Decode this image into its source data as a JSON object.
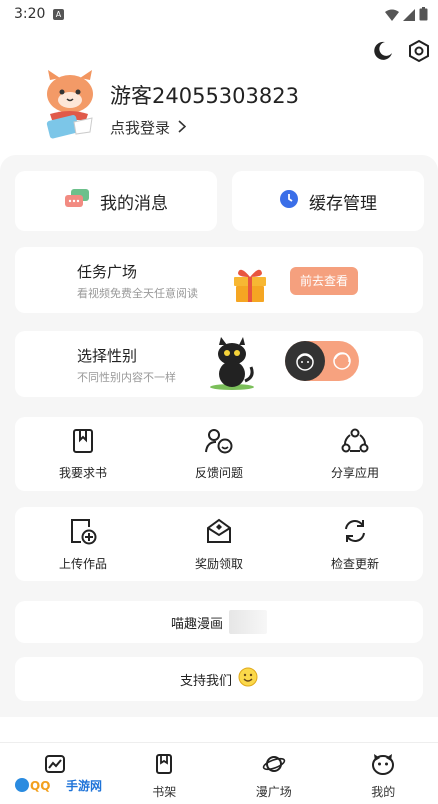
{
  "status_bar": {
    "time": "3:20",
    "notification_letter": "A"
  },
  "profile": {
    "username": "游客24055303823",
    "login_prompt": "点我登录"
  },
  "quick_actions": {
    "messages_label": "我的消息",
    "cache_label": "缓存管理"
  },
  "task_card": {
    "title": "任务广场",
    "subtitle": "看视频免费全天任意阅读",
    "button_label": "前去查看"
  },
  "gender_card": {
    "title": "选择性别",
    "subtitle": "不同性别内容不一样",
    "selected": "male"
  },
  "grid_row_1": [
    {
      "label": "我要求书",
      "icon": "book-request-icon"
    },
    {
      "label": "反馈问题",
      "icon": "feedback-icon"
    },
    {
      "label": "分享应用",
      "icon": "share-icon"
    }
  ],
  "grid_row_2": [
    {
      "label": "上传作品",
      "icon": "upload-icon"
    },
    {
      "label": "奖励领取",
      "icon": "reward-mail-icon"
    },
    {
      "label": "检查更新",
      "icon": "refresh-icon"
    }
  ],
  "app_info": {
    "label": "喵趣漫画"
  },
  "support": {
    "label": "支持我们"
  },
  "tabs": [
    {
      "label": "",
      "icon": "comic-home-icon"
    },
    {
      "label": "书架",
      "icon": "bookshelf-icon"
    },
    {
      "label": "漫广场",
      "icon": "planet-icon"
    },
    {
      "label": "我的",
      "icon": "cat-face-icon"
    }
  ],
  "watermark": {
    "text": "手游网"
  },
  "colors": {
    "accent": "#f5a07e",
    "panel_bg": "#f6f6f6",
    "dark": "#333333"
  }
}
